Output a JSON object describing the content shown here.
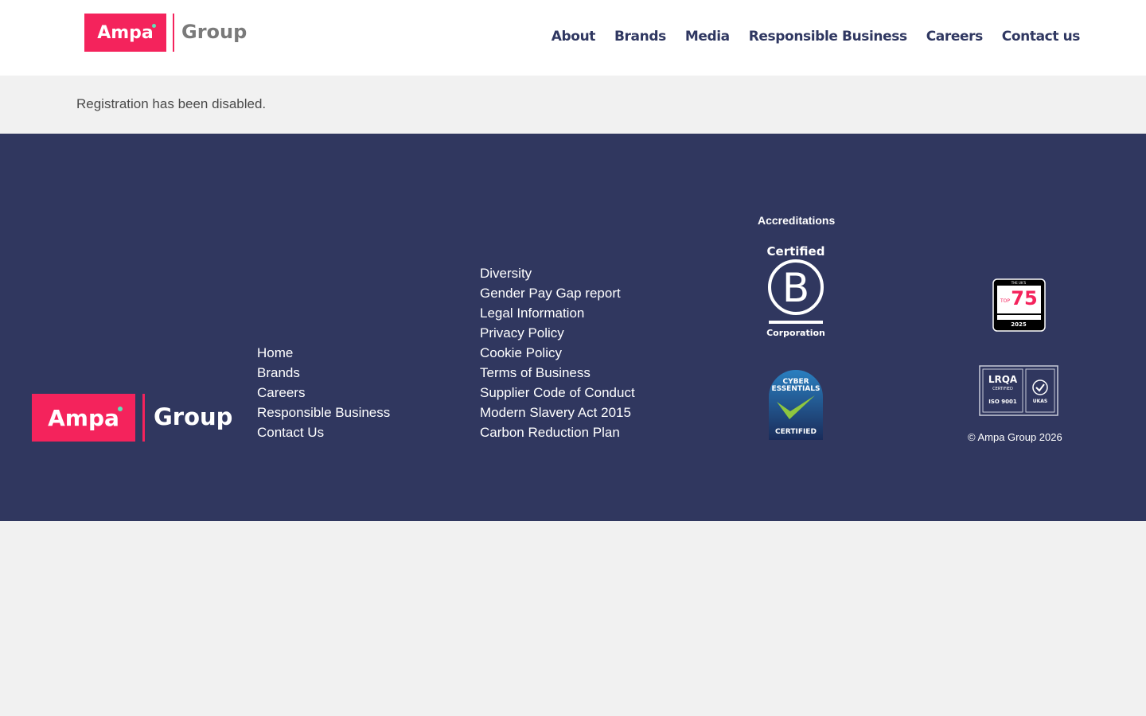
{
  "header": {
    "logo": {
      "brand": "Ampa",
      "suffix": "Group"
    },
    "nav": [
      "About",
      "Brands",
      "Media",
      "Responsible Business",
      "Careers",
      "Contact us"
    ]
  },
  "message": "Registration has been disabled.",
  "footer": {
    "logo": {
      "brand": "Ampa",
      "suffix": "Group"
    },
    "links_primary": [
      "Home",
      "Brands",
      "Careers",
      "Responsible Business",
      "Contact Us"
    ],
    "links_secondary": [
      "Diversity",
      "Gender Pay Gap report",
      "Legal Information",
      "Privacy Policy",
      "Cookie Policy",
      "Terms of Business",
      "Supplier Code of Conduct",
      "Modern Slavery Act 2015",
      "Carbon Reduction Plan"
    ],
    "accreditations_title": "Accreditations",
    "badges": {
      "bcorp": {
        "top": "Certified",
        "letter": "B",
        "bottom": "Corporation"
      },
      "cyber": {
        "line1": "CYBER",
        "line2": "ESSENTIALS",
        "bottom": "CERTIFIED"
      },
      "top75": {
        "small_top": "THE UK'S",
        "prefix": "TOP",
        "number": "75",
        "year": "2025"
      },
      "lrqa": {
        "brand": "LRQA",
        "certified": "CERTIFIED",
        "iso": "ISO 9001",
        "ukas": "UKAS"
      }
    },
    "copyright": "© Ampa Group 2026"
  },
  "colors": {
    "brand_pink": "#f4235c",
    "navy": "#30375f",
    "accent_green": "#5fe3b8"
  }
}
